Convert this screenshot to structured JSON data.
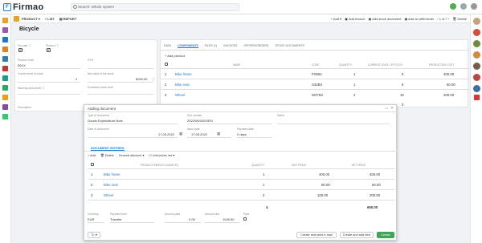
{
  "app": {
    "logo": "Firmao",
    "search_placeholder": "Search: Whole system"
  },
  "toolbar": {
    "product_label": "PRODUCT",
    "list_label": "LIST",
    "report_label": "REPORT",
    "add_label": "Add",
    "add_invoice": "Add invoice",
    "add_stock_doc": "Add stock document",
    "add_offer": "Add an offer/order",
    "pager": "of 7",
    "pager_current": "1",
    "delete": "Delete"
  },
  "product": {
    "name": "Bicycle",
    "for_sale_label": "For sale ⓘ",
    "for_sale": "✔",
    "product_label": "Product ⓘ",
    "product": "✔",
    "product_code_label": "Product code",
    "product_code": "B01X",
    "gtu_label": "GTU",
    "gtu": "",
    "current_stock_label": "Current level of stock",
    "current_stock": "2",
    "net_value_label": "Net value of the stock",
    "net_value": "6000.00",
    "warning_label": "Warning stock level ⓘ",
    "warning": "",
    "exceeded_label": "Exceeded stock level",
    "exceeded": "",
    "description_label": "Description"
  },
  "tabs": [
    "DATA",
    "COMPONENTS",
    "FILES (1)",
    "INVOICES",
    "OFFERS/ORDERS",
    "STOCK DOCUMENTS"
  ],
  "components": {
    "add_label": "Add product",
    "headers": [
      "",
      "NAME",
      "CODE",
      "QUANTITY",
      "CURRENT LEVEL OF STOCK",
      "PRODUCTION COST"
    ],
    "rows": [
      {
        "num": "1",
        "name": "Bike frame",
        "code": "F02B4",
        "qty": "1",
        "stock": "5",
        "cost": "400.00"
      },
      {
        "num": "2",
        "name": "Bike seat",
        "code": "S32BX",
        "qty": "1",
        "stock": "5",
        "cost": "50.00"
      },
      {
        "num": "3",
        "name": "Wheel",
        "code": "W376X",
        "qty": "2",
        "stock": "15",
        "cost": "200.00"
      }
    ],
    "total": "0"
  },
  "modal": {
    "title": "Adding document",
    "type_label": "Type of document",
    "type_value": "Goods Expenditure Note",
    "docnum_label": "Doc number",
    "docnum_value": "2022/05/002/SEN",
    "name_label": "Name",
    "date_label": "Date of document",
    "date_value": "17.05.2022",
    "issue_label": "Issue date",
    "issue_value": "17.05.2022",
    "payment_label": "Payment date",
    "payment_value": "0 days",
    "section_title": "DOCUMENT ENTRIES",
    "add_label": "Add",
    "delete_label": "Delete",
    "general_label": "General discount",
    "unit_net_label": "Unit prices net",
    "headers": [
      "",
      "PRODUCT/SERVICE (NAME ID)",
      "QUANTITY",
      "UNIT PRICE",
      "NET PRICE"
    ],
    "rows": [
      {
        "num": "1",
        "name": "Bike frame",
        "qty": "1",
        "unit": "400.00",
        "net": "400.00"
      },
      {
        "num": "2",
        "name": "Bike seat",
        "qty": "1",
        "unit": "50.00",
        "net": "50.00"
      },
      {
        "num": "3",
        "name": "Wheel",
        "qty": "2",
        "unit": "100.00",
        "net": "200.00"
      }
    ],
    "qty_total": "4",
    "net_total": "650.00",
    "currency_label": "Currency",
    "currency": "EUR",
    "payment_kind_label": "Payment kind",
    "payment_kind": "Transfer",
    "amount_paid_label": "Amount paid",
    "amount_paid": "0.00",
    "amount_due_label": "Amount due",
    "amount_due": "1045.50",
    "paid_label": "Paid",
    "btn_send": "Create and send e-mail",
    "btn_next": "Create and add next",
    "btn_create": "Create"
  },
  "colors": {
    "accent": "#1a7bd0",
    "toolbar_icon": "#f0a020",
    "create": "#3aa856"
  }
}
